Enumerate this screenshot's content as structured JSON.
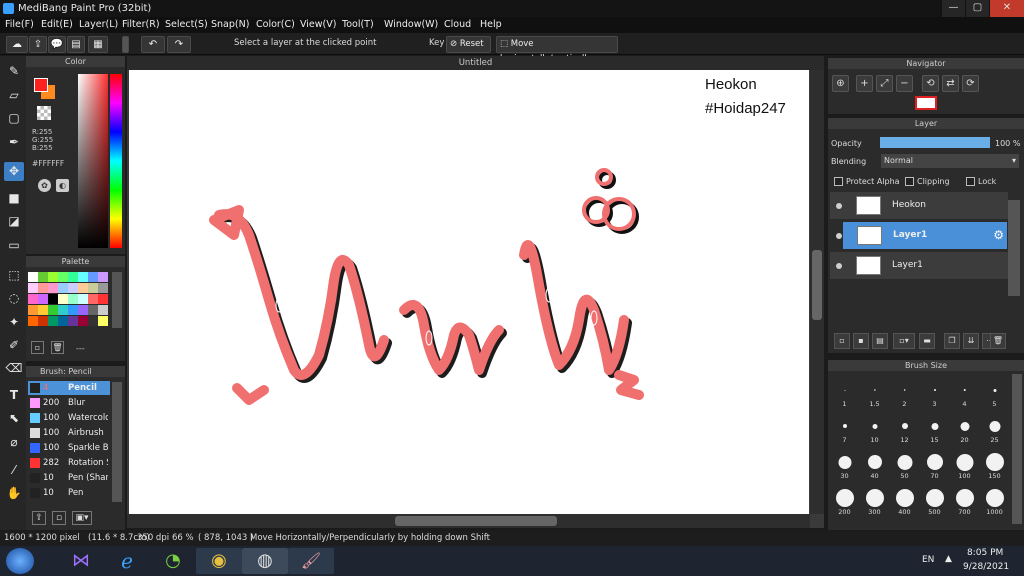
{
  "window": {
    "title": "MediBang Paint Pro (32bit)",
    "controls": [
      "—",
      "▢",
      "✕"
    ]
  },
  "menu": [
    "File(F)",
    "Edit(E)",
    "Layer(L)",
    "Filter(R)",
    "Select(S)",
    "Snap(N)",
    "Color(C)",
    "View(V)",
    "Tool(T)",
    "Window(W)",
    "Cloud",
    "Help"
  ],
  "toolbar": {
    "select_layer_label": "Select a layer at the clicked point",
    "key_label": "Key",
    "reset_label": "Reset",
    "move_label": "Move horizontally/vertically"
  },
  "color_panel": {
    "title": "Color",
    "r": "R:255",
    "g": "G:255",
    "b": "B:255",
    "hex": "#FFFFFF"
  },
  "palette_panel": {
    "title": "Palette",
    "more": "---",
    "colors": [
      "#ffffff",
      "#66cc33",
      "#99ff33",
      "#66ff66",
      "#33ff99",
      "#66ffff",
      "#6699ff",
      "#cc99ff",
      "#ffccff",
      "#ff9999",
      "#ff99cc",
      "#99ccff",
      "#ccccff",
      "#ffcc99",
      "#cccc99",
      "#999999",
      "#ff66cc",
      "#cc66ff",
      "#000000",
      "#ffffcc",
      "#99ffcc",
      "#ccffff",
      "#ff6666",
      "#ff3333",
      "#ff9933",
      "#ffcc33",
      "#33cc33",
      "#33cccc",
      "#3399ff",
      "#9966ff",
      "#666666",
      "#cccccc",
      "#ff6600",
      "#cc3300",
      "#009966",
      "#006699",
      "#663399",
      "#990033",
      "#333333",
      "#ffff66"
    ]
  },
  "brush_panel": {
    "title": "Brush: Pencil",
    "brushes": [
      {
        "size": "4",
        "name": "Pencil",
        "color": "#222222",
        "selected": true
      },
      {
        "size": "200",
        "name": "Blur",
        "color": "#ff99ff"
      },
      {
        "size": "100",
        "name": "Watercolor",
        "color": "#66ccff"
      },
      {
        "size": "100",
        "name": "Airbrush",
        "color": "#dddddd"
      },
      {
        "size": "100",
        "name": "Sparkle Brush",
        "color": "#3366ff"
      },
      {
        "size": "282",
        "name": "Rotation Symmetry",
        "color": "#ff3333"
      },
      {
        "size": "10",
        "name": "Pen (Sharp)",
        "color": "#222222"
      },
      {
        "size": "10",
        "name": "Pen",
        "color": "#222222"
      }
    ]
  },
  "canvas": {
    "title": "Untitled",
    "watermark_line1": "Heokon",
    "watermark_line2": "#Hoidap247",
    "stroke_color": "#f07070"
  },
  "navigator": {
    "title": "Navigator"
  },
  "layer_panel": {
    "title": "Layer",
    "opacity_label": "Opacity",
    "opacity_value": "100 %",
    "opacity_fraction": 1.0,
    "blending_label": "Blending",
    "blending_value": "Normal",
    "protect_alpha": "Protect Alpha",
    "clipping": "Clipping",
    "lock": "Lock",
    "layers": [
      {
        "name": "Heokon",
        "selected": false
      },
      {
        "name": "Layer1",
        "selected": true
      },
      {
        "name": "Layer1",
        "selected": false
      }
    ]
  },
  "brush_size_panel": {
    "title": "Brush Size",
    "sizes": [
      "1",
      "1.5",
      "2",
      "3",
      "4",
      "5",
      "7",
      "10",
      "12",
      "15",
      "20",
      "25",
      "30",
      "40",
      "50",
      "70",
      "100",
      "150",
      "200",
      "300",
      "400",
      "500",
      "700",
      "1000"
    ]
  },
  "status": {
    "dims": "1600 * 1200 pixel",
    "cm": "(11.6 * 8.7cm)",
    "dpi": "350 dpi",
    "zoom": "66 %",
    "coords": "( 878, 1043 )",
    "hint": "Move Horizontally/Perpendicularly by holding down Shift"
  },
  "taskbar": {
    "lang": "EN",
    "time": "8:05 PM",
    "date": "9/28/2021"
  }
}
